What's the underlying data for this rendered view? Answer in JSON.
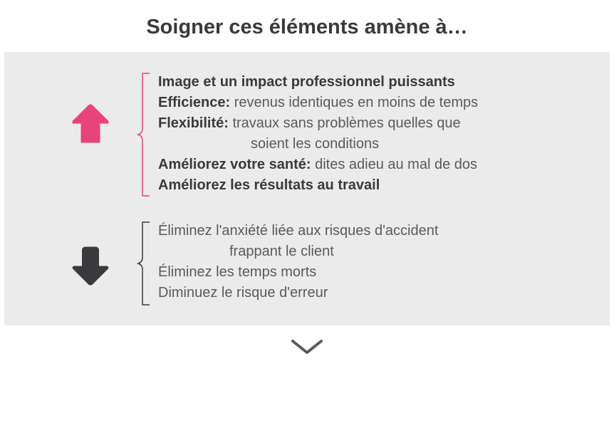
{
  "title": "Soigner ces éléments amène à…",
  "colors": {
    "pink": "#e6447a",
    "dark": "#3a3a3c",
    "text": "#5a5a5c"
  },
  "up": {
    "lines": {
      "l1_bold": "Image et un impact professionnel puissants",
      "l2_bold": "Efficience:",
      "l2_rest": " revenus identiques en moins de temps",
      "l3_bold": "Flexibilité:",
      "l3_rest": " travaux sans problèmes quelles que",
      "l3_cont": "soient les conditions",
      "l4_bold": "Améliorez votre santé:",
      "l4_rest": " dites adieu au mal de dos",
      "l5_bold": "Améliorez les résultats au travail"
    }
  },
  "down": {
    "lines": {
      "l1": "Éliminez l'anxiété liée aux risques d'accident",
      "l1_cont": "frappant le client",
      "l2": "Éliminez les temps morts",
      "l3": "Diminuez le risque d'erreur"
    }
  }
}
